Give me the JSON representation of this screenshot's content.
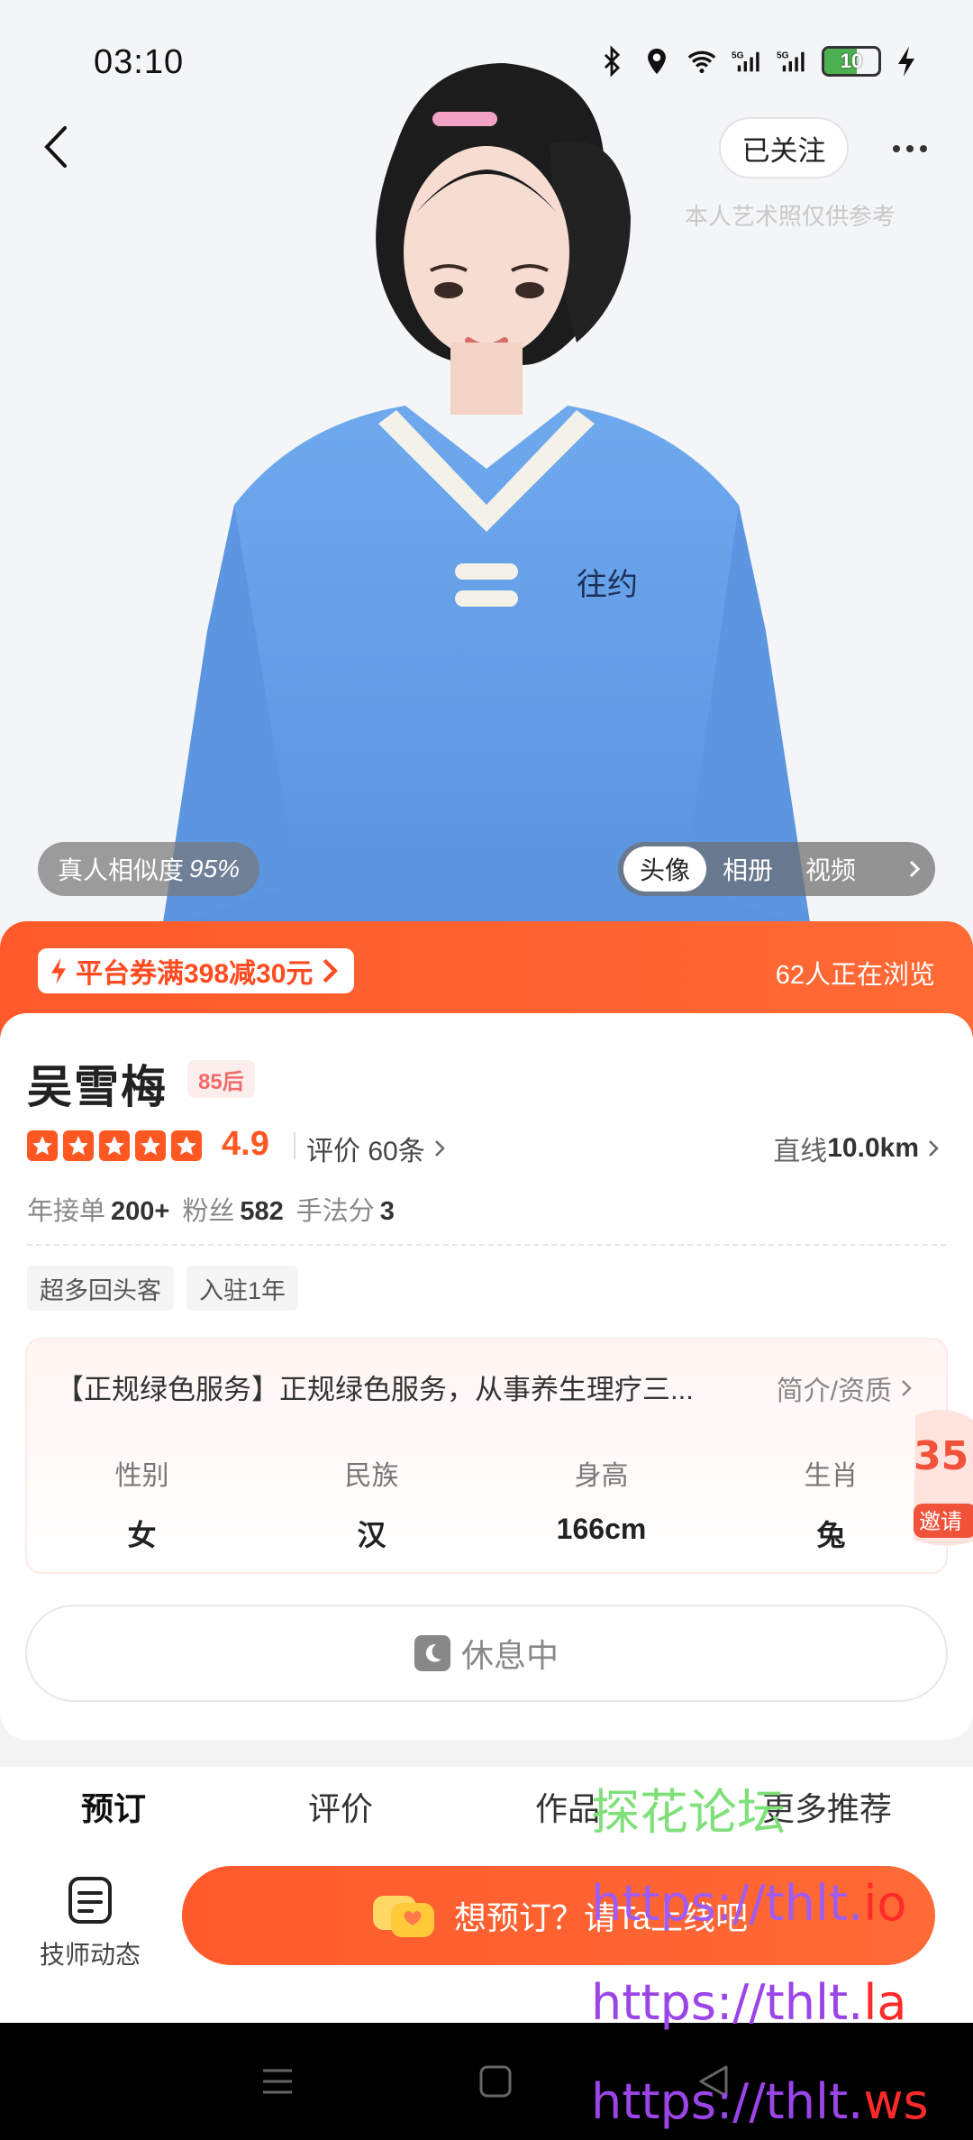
{
  "status_bar": {
    "time": "03:10",
    "battery": "10",
    "icons": [
      "bluetooth-icon",
      "location-icon",
      "wifi-icon",
      "signal-5g-icon",
      "signal-5g-icon",
      "battery-icon",
      "charging-icon"
    ]
  },
  "header": {
    "follow_label": "已关注",
    "art_note": "本人艺术照仅供参考"
  },
  "hero": {
    "similarity_label": "真人相似度",
    "similarity_value": "95%",
    "media_tabs": [
      "头像",
      "相册",
      "视频"
    ]
  },
  "promo": {
    "coupon": "平台券满398减30元",
    "viewers": "62人正在浏览"
  },
  "profile": {
    "name": "吴雪梅",
    "age_badge": "85后",
    "rating": "4.9",
    "reviews": "评价 60条",
    "distance_label": "直线",
    "distance_value": "10.0km",
    "stats": {
      "orders_label": "年接单",
      "orders_value": "200+",
      "fans_label": "粉丝",
      "fans_value": "582",
      "skill_label": "手法分",
      "skill_value": "3"
    },
    "tags": [
      "超多回头客",
      "入驻1年"
    ],
    "intro": "【正规绿色服务】正规绿色服务，从事养生理疗三...",
    "intro_link": "简介/资质",
    "attributes": [
      {
        "label": "性别",
        "value": "女"
      },
      {
        "label": "民族",
        "value": "汉"
      },
      {
        "label": "身高",
        "value": "166cm"
      },
      {
        "label": "生肖",
        "value": "兔"
      }
    ],
    "floating_badge": {
      "number": "35",
      "label": "邀请"
    },
    "status_button": "休息中"
  },
  "section_tabs": [
    "预订",
    "评价",
    "作品",
    "更多推荐"
  ],
  "action_bar": {
    "dynamic_label": "技师动态",
    "book_label": "想预订？请Ta上线吧"
  },
  "watermark": {
    "line1": "探花论坛",
    "line2_prefix": "https://thlt.",
    "line2_suffix": "io",
    "line3_prefix": "https://thlt.",
    "line3_suffix": "la",
    "line4_prefix": "https://thlt.",
    "line4_suffix": "ws"
  },
  "colors": {
    "accent": "#ff5a2c",
    "star": "#ff5722",
    "badge_text": "#f06a6a"
  }
}
